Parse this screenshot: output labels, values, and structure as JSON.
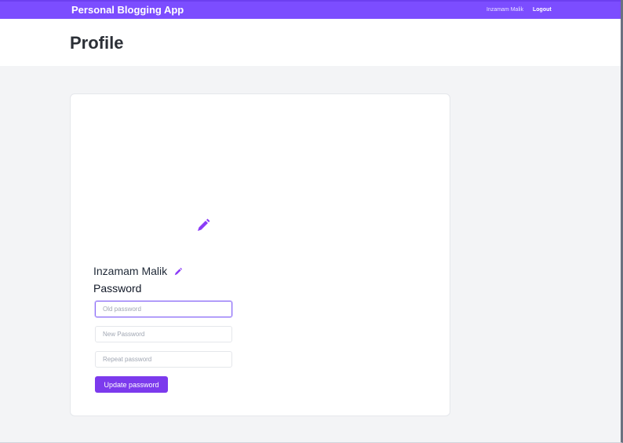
{
  "navbar": {
    "brand": "Personal Blogging App",
    "user_name": "Inzamam Malik",
    "logout_label": "Logout"
  },
  "header": {
    "title": "Profile"
  },
  "profile": {
    "avatar_edit_icon": "pencil-icon",
    "name": "Inzamam Malik",
    "name_edit_icon": "pencil-icon",
    "password_heading": "Password",
    "fields": [
      {
        "placeholder": "Old password",
        "value": "",
        "focused": true
      },
      {
        "placeholder": "New Password",
        "value": ""
      },
      {
        "placeholder": "Repeat password",
        "value": ""
      }
    ],
    "update_button_label": "Update password"
  },
  "colors": {
    "accent": "#7c4dff",
    "button": "#7c3aed",
    "page_bg": "#f3f4f6"
  }
}
